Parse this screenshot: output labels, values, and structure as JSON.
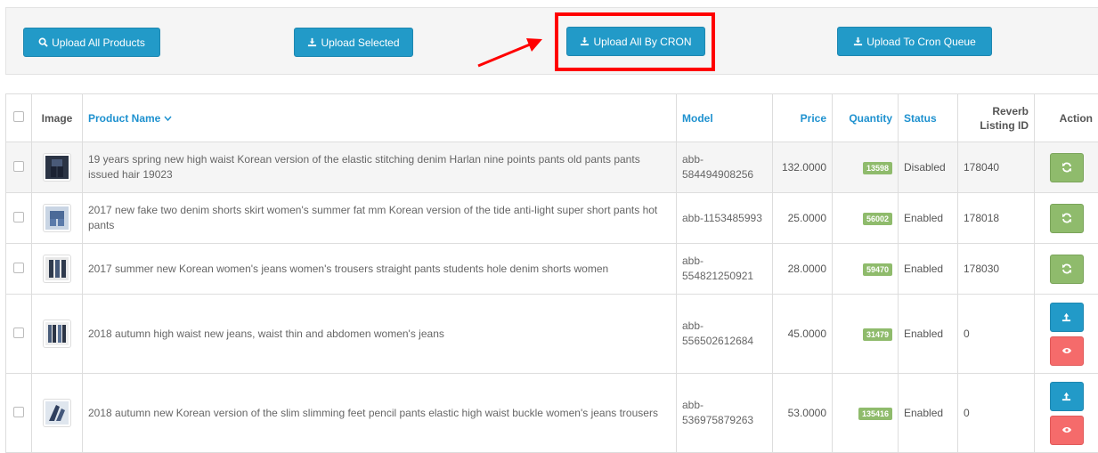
{
  "toolbar": {
    "upload_all_products": "Upload All Products",
    "upload_selected": "Upload Selected",
    "upload_all_by_cron": "Upload All By CRON",
    "upload_to_cron_queue": "Upload To Cron Queue"
  },
  "table": {
    "headers": {
      "image": "Image",
      "product_name": "Product Name",
      "model": "Model",
      "price": "Price",
      "quantity": "Quantity",
      "status": "Status",
      "listing_id": "Reverb Listing ID",
      "action": "Action"
    },
    "rows": [
      {
        "name": "19 years spring new high waist Korean version of the elastic stitching denim Harlan nine points pants old pants pants issued hair 19023",
        "model": "abb-584494908256",
        "price": "132.0000",
        "quantity": "13598",
        "status": "Disabled",
        "listing_id": "178040"
      },
      {
        "name": "2017 new fake two denim shorts skirt women's summer fat mm Korean version of the tide anti-light super short pants hot pants",
        "model": "abb-1153485993",
        "price": "25.0000",
        "quantity": "56002",
        "status": "Enabled",
        "listing_id": "178018"
      },
      {
        "name": "2017 summer new Korean women's jeans women's trousers straight pants students hole denim shorts women",
        "model": "abb-554821250921",
        "price": "28.0000",
        "quantity": "59470",
        "status": "Enabled",
        "listing_id": "178030"
      },
      {
        "name": "2018 autumn high waist new jeans, waist thin and abdomen women's jeans",
        "model": "abb-556502612684",
        "price": "45.0000",
        "quantity": "31479",
        "status": "Enabled",
        "listing_id": "0"
      },
      {
        "name": "2018 autumn new Korean version of the slim slimming feet pencil pants elastic high waist buckle women's jeans trousers",
        "model": "abb-536975879263",
        "price": "53.0000",
        "quantity": "135416",
        "status": "Enabled",
        "listing_id": "0"
      }
    ]
  },
  "colors": {
    "primary": "#229ac8",
    "success": "#8fbb6c",
    "danger": "#f56b6b",
    "link": "#1e91cf",
    "highlight": "#ff0000"
  }
}
